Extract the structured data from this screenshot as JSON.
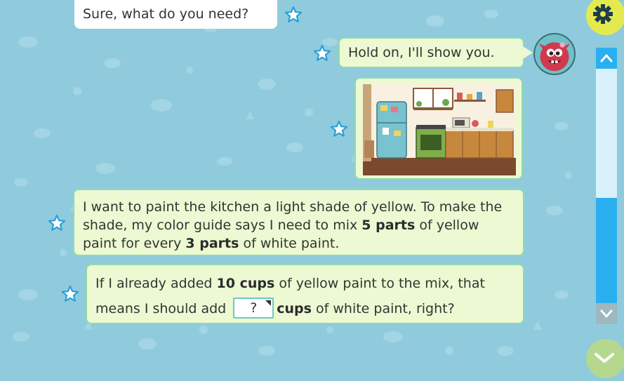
{
  "messages": {
    "m1": {
      "text": "Sure, what do you need?"
    },
    "m2": {
      "text": "Hold on, I'll show you."
    },
    "m4": {
      "p1": "I want to paint the kitchen a light shade of yellow. To make the shade, my color guide says I need to mix ",
      "b1": "5 parts",
      "p2": " of yellow paint for every ",
      "b2": "3 parts",
      "p3": " of white paint."
    },
    "m5": {
      "p1": "If I already added ",
      "b1": "10 cups",
      "p2": " of yellow paint to the mix, that means I should add ",
      "answer": "?",
      "b2": "cups",
      "p3": " of white paint, right?"
    }
  },
  "icons": {
    "star": "star-outline-icon",
    "settings": "gear-icon",
    "scroll_up": "chevron-up-icon",
    "scroll_down": "chevron-down-icon",
    "next": "chevron-down-icon"
  },
  "colors": {
    "background": "#8fcbdc",
    "bubble_green": "#ecf9d2",
    "bubble_border": "#93d9a8",
    "star": "#2a9fd8",
    "scroll_thumb": "#2ab0f0",
    "settings_button": "#e4ea4e",
    "next_button": "#b6d88e"
  }
}
